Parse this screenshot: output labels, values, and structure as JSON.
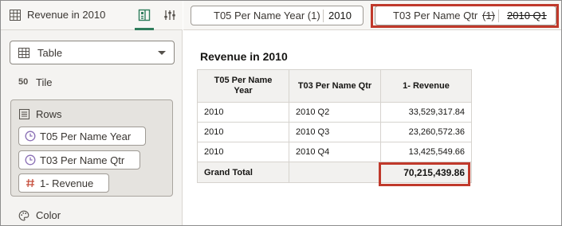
{
  "panel": {
    "title": "Revenue in 2010",
    "viz_type": "Table",
    "tile_label": "Tile",
    "tile_icon_text": "50",
    "rows_label": "Rows",
    "rows_items": [
      {
        "label": "T05 Per Name Year",
        "icon": "clock-icon"
      },
      {
        "label": "T03 Per Name Qtr",
        "icon": "clock-icon"
      },
      {
        "label": "1- Revenue",
        "icon": "hash-icon"
      }
    ],
    "color_label": "Color"
  },
  "filters": [
    {
      "name": "T05 Per Name Year (1)",
      "value": "2010",
      "excluded": false
    },
    {
      "name": "T03 Per Name Qtr",
      "count": "(1)",
      "value": "2010 Q1",
      "excluded": true
    }
  ],
  "viz": {
    "title": "Revenue in 2010",
    "headers": [
      "T05 Per Name Year",
      "T03 Per Name Qtr",
      "1- Revenue"
    ],
    "rows": [
      [
        "2010",
        "2010 Q2",
        "33,529,317.84"
      ],
      [
        "2010",
        "2010 Q3",
        "23,260,572.36"
      ],
      [
        "2010",
        "2010 Q4",
        "13,425,549.66"
      ]
    ],
    "total_label": "Grand Total",
    "total_value": "70,215,439.86"
  },
  "colors": {
    "accent": "#2f7d5c",
    "highlight": "#c0392b",
    "time_icon": "#8a6fb5",
    "measure_icon": "#c7513f"
  }
}
